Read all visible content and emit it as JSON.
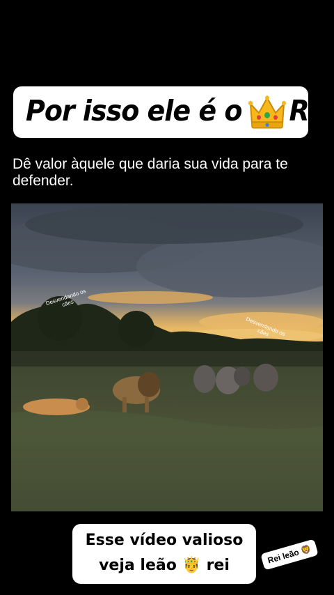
{
  "header": {
    "title_before": "Por isso ele é o",
    "crown_icon": "crown-emoji",
    "title_after": "REI"
  },
  "caption": "Dê valor àquele que daria sua vida para te defender.",
  "video": {
    "watermark_1": "Desvendando os cães",
    "watermark_2": "Desvendando os cães"
  },
  "bottom_text": {
    "line1": "Esse vídeo valioso",
    "line2_before": "veja leão",
    "line2_emoji": "🤴",
    "line2_after": "rei"
  },
  "tag": {
    "label": "Rei leão",
    "emoji": "🦁"
  }
}
